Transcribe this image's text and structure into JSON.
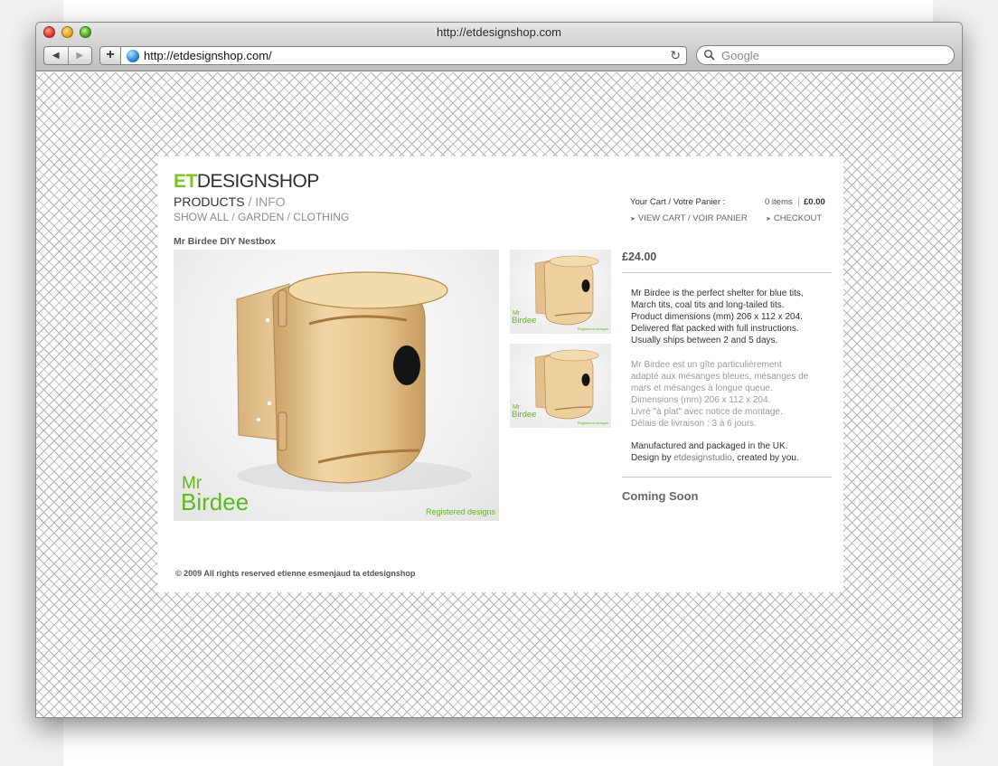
{
  "window": {
    "title": "http://etdesignshop.com",
    "url": "http://etdesignshop.com/",
    "search_placeholder": "Google",
    "back_label": "◀",
    "forward_label": "▶",
    "add_label": "+",
    "reload_label": "↻"
  },
  "site": {
    "logo_et": "ET",
    "logo_rest": "DESIGNSHOP",
    "nav_products": "PRODUCTS",
    "nav_sep": " / ",
    "nav_info": "INFO",
    "subnav": [
      "SHOW ALL",
      "GARDEN",
      "CLOTHING"
    ],
    "subnav_sep": " / "
  },
  "cart": {
    "label": "Your Cart / Votre Panier :",
    "items": "0 items",
    "total": "£0.00",
    "view_link": "VIEW CART / VOIR PANIER",
    "checkout_link": "CHECKOUT"
  },
  "product": {
    "title": "Mr Birdee DIY Nestbox",
    "brand_mr": "Mr",
    "brand_birdee": "Birdee",
    "registered": "Registered designs",
    "price": "£24.00",
    "desc_en": [
      "Mr Birdee is the perfect shelter for blue tits,",
      "March tits, coal tits and long-tailed tits.",
      "Product dimensions (mm) 206 x 112 x 204.",
      "Delivered flat packed with full instructions.",
      "Usually ships between 2 and 5 days."
    ],
    "desc_fr": [
      "Mr Birdee est un gîte particulièrement",
      "adapté aux mésanges bleues, mésanges de",
      "mars et mésanges à longue queue.",
      "Dimensions (mm) 206 x 112 x 204.",
      "Livré \"à plat\" avec notice de montage.",
      "Délais de livraison : 3 à 6 jours."
    ],
    "made_line": "Manufactured and packaged in the UK.",
    "design_prefix": "Design by ",
    "design_link": "etdesignstudio",
    "design_suffix": ", created by you.",
    "coming_soon": "Coming Soon"
  },
  "footer": {
    "text": "© 2009 All rights reserved etienne esmenjaud ta etdesignshop"
  },
  "colors": {
    "brand_green": "#7bc41f",
    "image_green": "#5fb71c"
  }
}
